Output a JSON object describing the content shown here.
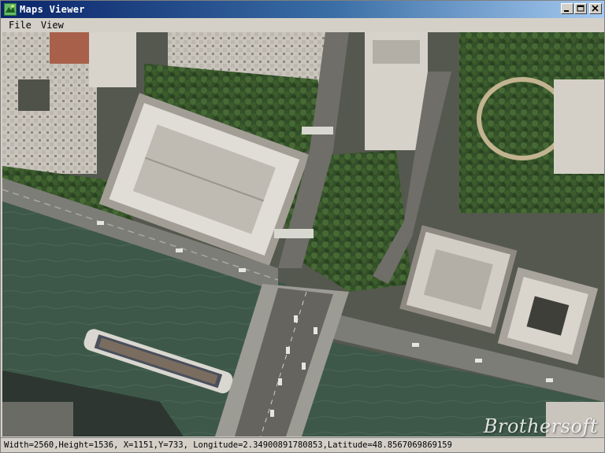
{
  "window": {
    "title": "Maps Viewer",
    "icon": "app-map-icon"
  },
  "menu": {
    "file_label": "File",
    "view_label": "View"
  },
  "status": {
    "text": "Width=2560,Height=1536, X=1151,Y=733, Longitude=2.34900891780853,Latitude=48.8567069869159"
  },
  "watermark": {
    "text": "Brothersoft"
  },
  "colors": {
    "titlebar_start": "#0a246a",
    "titlebar_end": "#a6caf0",
    "river": "#3f5a4a",
    "road": "#8a8a86",
    "trees": "#2f4a24"
  }
}
